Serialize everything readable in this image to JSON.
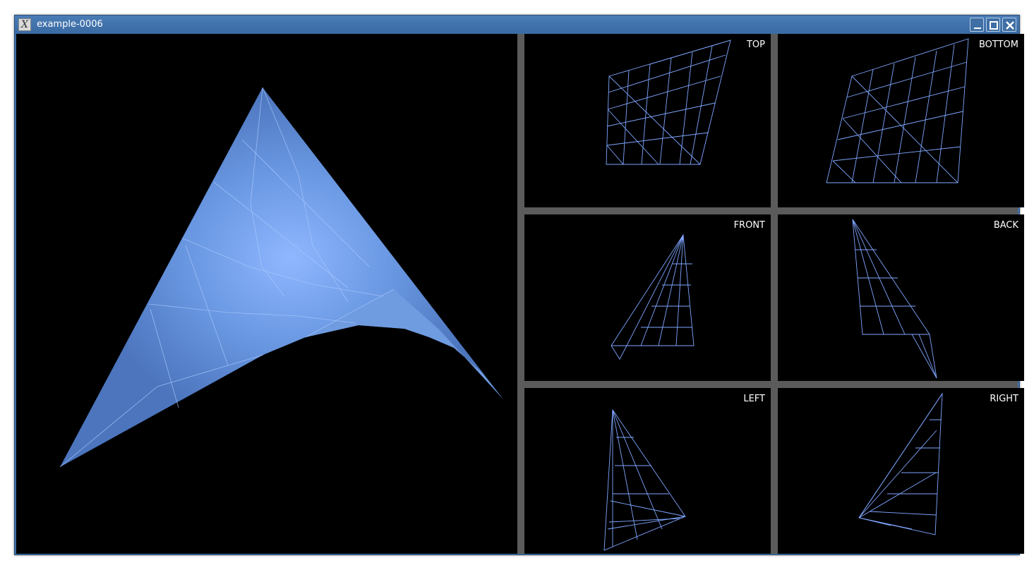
{
  "window": {
    "title": "example-0006",
    "app_icon": "x-logo-icon",
    "controls": [
      "minimize-icon",
      "maximize-icon",
      "close-icon"
    ]
  },
  "main_view": {
    "surface_color": "#6f9fe8",
    "edge_color": "#a9c8ff"
  },
  "views": [
    {
      "label": "TOP"
    },
    {
      "label": "BOTTOM"
    },
    {
      "label": "FRONT"
    },
    {
      "label": "BACK"
    },
    {
      "label": "LEFT"
    },
    {
      "label": "RIGHT"
    }
  ],
  "colors": {
    "title_bar": "#3f6fa5",
    "viewport_background": "#000000",
    "divider": "#5b5b5b",
    "wireframe": "#7fa6ff"
  }
}
